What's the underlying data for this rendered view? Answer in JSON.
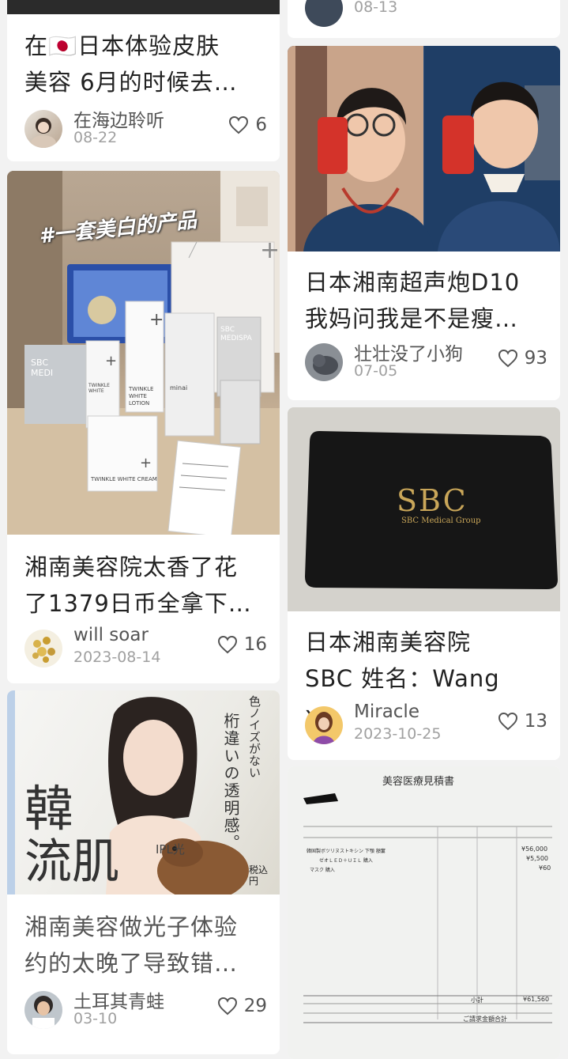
{
  "cards": [
    {
      "title_line1": "在🇯🇵日本体验皮肤",
      "title_line2": "美容 6月的时候去…",
      "author": "在海边聆听",
      "date": "08-22",
      "likes": "6"
    },
    {
      "date": "08-13"
    },
    {
      "title_line1": "日本湘南超声炮D10",
      "title_line2": "我妈问我是不是瘦…",
      "author": "壮壮没了小狗",
      "date": "07-05",
      "likes": "93"
    },
    {
      "image_caption": "#一套美白的产品",
      "product_labels": [
        "SBC MEDI",
        "SBC MEDISPA",
        "TWINKLE WHITE LOTION",
        "TWINKLE WHITE CREAM",
        "TWINKLE WHITE",
        "minai"
      ],
      "title_line1": "湘南美容院太香了花",
      "title_line2": "了1379日币全拿下…",
      "author": "will soar",
      "date": "2023-08-14",
      "likes": "16"
    },
    {
      "card_brand": "SBC",
      "card_sub": "SBC Medical Group",
      "title_line1": "日本湘南美容院",
      "title_line2": "SBC 姓名：Wang x…",
      "author": "Miracle",
      "date": "2023-10-25",
      "likes": "13"
    },
    {
      "ad_vertical_1": "色ノイズがない",
      "ad_vertical_2": "桁違いの透明感。",
      "ad_big_1": "韓",
      "ad_big_2": "流肌",
      "ad_small": "IPL光",
      "ad_price": "税込 円",
      "title_line1": "湘南美容做光子体验",
      "title_line2": "约的太晚了导致错…",
      "author": "土耳其青蛙",
      "date": "03-10",
      "likes": "29"
    },
    {
      "doc_title": "美容医療見積書",
      "doc_total_label": "ご請求金額合計",
      "doc_subtotal_label": "小計",
      "doc_total": "¥61,560",
      "doc_items": [
        {
          "name": "韓国製ボツリヌストキシン 下顎 額窶",
          "amount": "¥56,000"
        },
        {
          "name": "ゼオＬＥＤ＋ＵＩＬ 購入",
          "amount": "¥5,500"
        },
        {
          "name": "マスク 購入",
          "amount": "¥60"
        }
      ]
    }
  ],
  "colors": {
    "text": "#222222",
    "meta": "#555555",
    "date": "#a0a0a0",
    "bg": "#f2f2f2"
  }
}
